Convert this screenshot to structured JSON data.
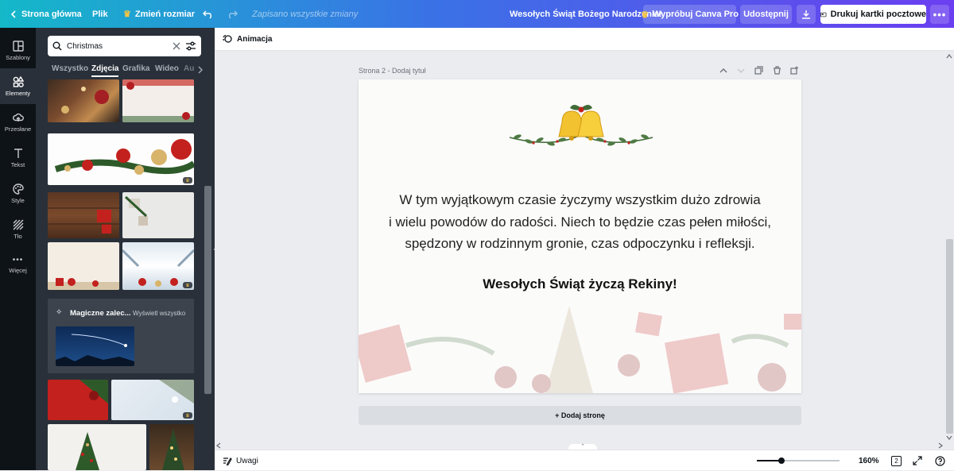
{
  "topbar": {
    "home_label": "Strona główna",
    "file_label": "Plik",
    "resize_label": "Zmień rozmiar",
    "saved_status": "Zapisano wszystkie zmiany",
    "design_title": "Wesołych Świąt Bożego Narodzenia!",
    "try_pro_label": "Wypróbuj Canva Pro",
    "share_label": "Udostępnij",
    "print_label": "Drukuj kartki pocztowe"
  },
  "rail": {
    "items": [
      {
        "label": "Szablony",
        "icon": "templates-icon"
      },
      {
        "label": "Elementy",
        "icon": "elements-icon"
      },
      {
        "label": "Przesłane",
        "icon": "upload-cloud-icon"
      },
      {
        "label": "Tekst",
        "icon": "text-icon"
      },
      {
        "label": "Style",
        "icon": "palette-icon"
      },
      {
        "label": "Tło",
        "icon": "background-icon"
      },
      {
        "label": "Więcej",
        "icon": "more-dots-icon"
      }
    ]
  },
  "panel": {
    "search_value": "Christmas",
    "tabs": [
      "Wszystko",
      "Zdjęcia",
      "Grafika",
      "Wideo",
      "Au"
    ],
    "magic_title": "Magiczne zalec...",
    "magic_link": "Wyświetl wszystko"
  },
  "canvas": {
    "animation_label": "Animacja",
    "page_label": "Strona 2 - Dodaj tytuł",
    "message_line1": "W tym wyjątkowym czasie życzymy wszystkim dużo zdrowia",
    "message_line2": "i wielu powodów do radości. Niech to będzie czas pełen miłości,",
    "message_line3": "spędzony w rodzinnym gronie, czas odpoczynku i refleksji.",
    "signature": "Wesołych Świąt życzą Rekiny!",
    "add_page_label": "+ Dodaj stronę"
  },
  "bottombar": {
    "notes_label": "Uwagi",
    "zoom": "160%",
    "page_count": "2",
    "zoom_slider_fraction": 0.3
  },
  "colors": {
    "accent": "#7d2ae8",
    "rail_bg": "#0e1318",
    "panel_bg": "#293039"
  }
}
